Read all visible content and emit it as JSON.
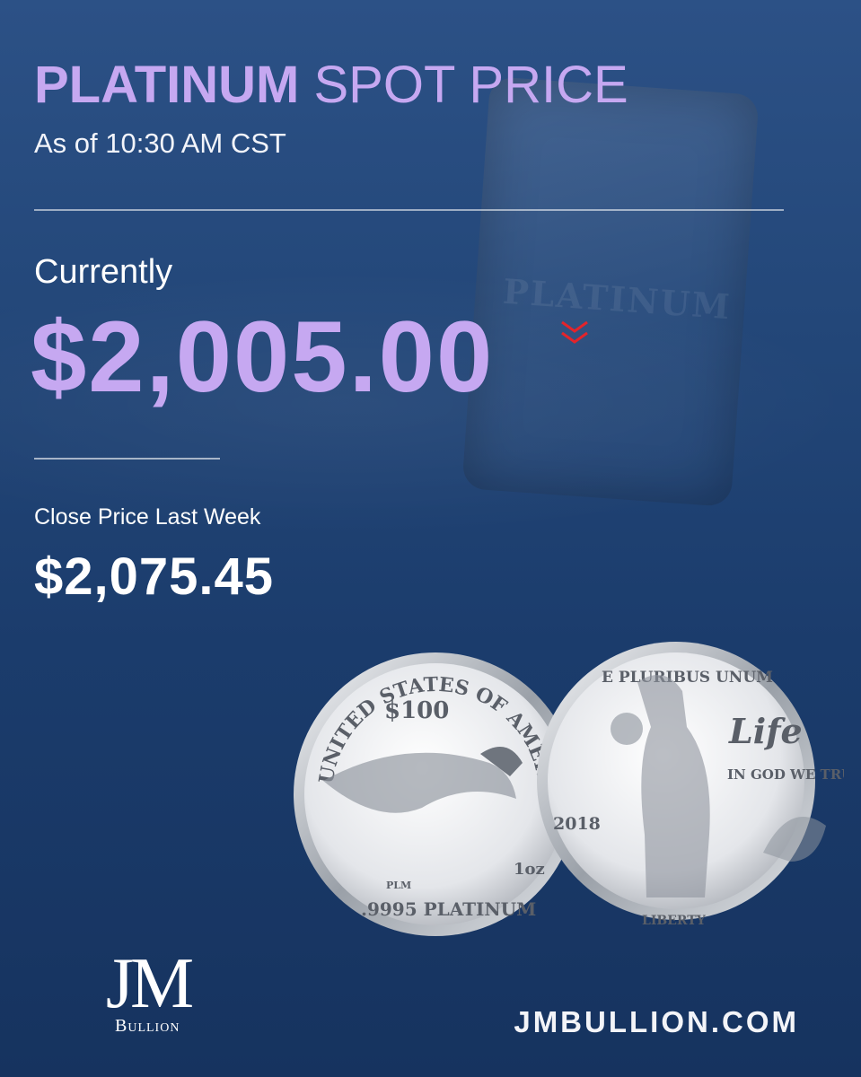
{
  "header": {
    "title_strong": "PLATINUM",
    "title_light": "SPOT PRICE",
    "timestamp": "As of 10:30 AM CST"
  },
  "current": {
    "label": "Currently",
    "price": "$2,005.00",
    "trend_icon": "double-chevron-down-icon",
    "trend_color": "#e3242b"
  },
  "last_week": {
    "label": "Close Price Last Week",
    "price": "$2,075.45"
  },
  "coins": {
    "obverse": {
      "country": "UNITED STATES OF AMERICA",
      "denomination": "$100",
      "fraction": "1oz",
      "purity": ".9995 PLATINUM",
      "initials": "PLM"
    },
    "reverse": {
      "motto_top": "E PLURIBUS UNUM",
      "word": "Life",
      "motto": "IN GOD WE TRUST",
      "year": "2018",
      "bottom": "LIBERTY"
    }
  },
  "background": {
    "bar_text": "PLATINUM"
  },
  "footer": {
    "logo_mark": "JM",
    "logo_word": "Bullion",
    "website": "JMBULLION.COM"
  },
  "colors": {
    "accent": "#c6a8f1",
    "background_top": "#2c5186",
    "background_bottom": "#16335f",
    "text": "#ffffff"
  }
}
